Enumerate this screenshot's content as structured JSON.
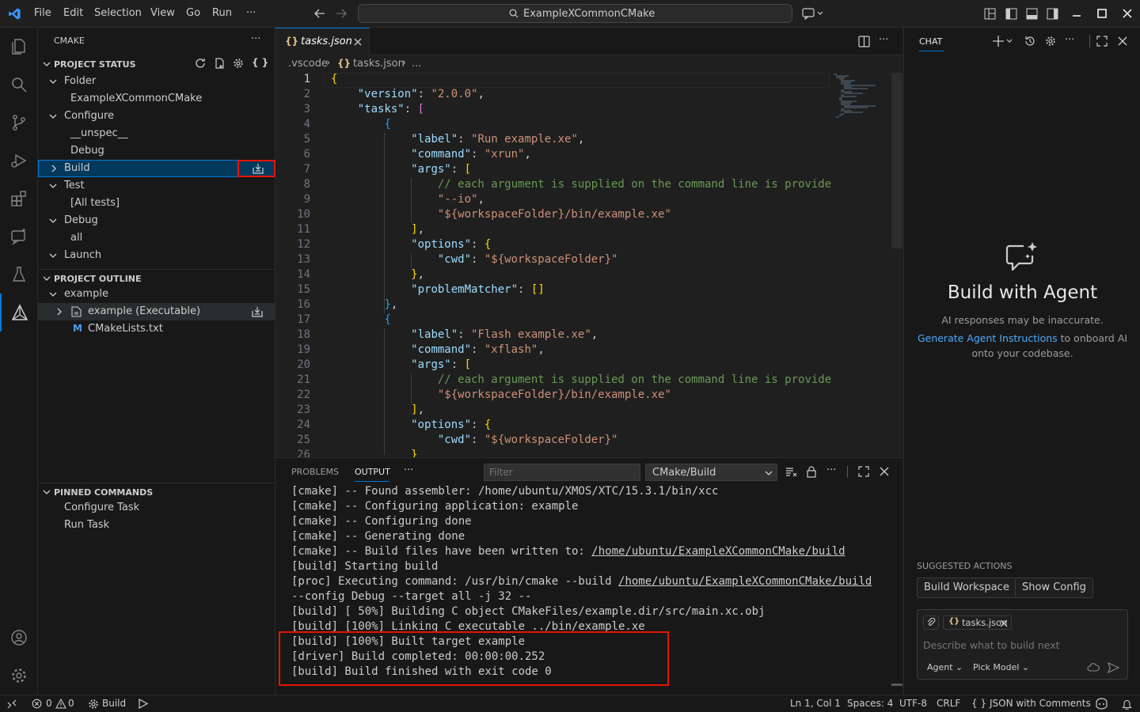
{
  "titlebar": {
    "menu": [
      "File",
      "Edit",
      "Selection",
      "View",
      "Go",
      "Run",
      "···"
    ],
    "search_text": "ExampleXCommonCMake"
  },
  "sidebar": {
    "title": "CMAKE",
    "more": "···",
    "project_status": {
      "header": "PROJECT STATUS",
      "folder": "Folder",
      "folder_value": "ExampleXCommonCMake",
      "configure": "Configure",
      "configure_preset": "__unspec__",
      "configure_type": "Debug",
      "build": "Build",
      "test": "Test",
      "test_value": "[All tests]",
      "debug": "Debug",
      "debug_value": "all",
      "launch": "Launch"
    },
    "project_outline": {
      "header": "PROJECT OUTLINE",
      "project": "example",
      "target": "example (Executable)",
      "file": "CMakeLists.txt"
    },
    "pinned": {
      "header": "PINNED COMMANDS",
      "items": [
        "Configure Task",
        "Run Task"
      ]
    }
  },
  "editor": {
    "tab_label": "tasks.json",
    "tab_icon": "{}",
    "breadcrumb": [
      ".vscode",
      "tasks.json",
      "..."
    ],
    "cursor_line": 1
  },
  "code_lines": [
    "{",
    "    \"version\": \"2.0.0\",",
    "    \"tasks\": [",
    "        {",
    "            \"label\": \"Run example.xe\",",
    "            \"command\": \"xrun\",",
    "            \"args\": [",
    "                // each argument is supplied on the command line is provide",
    "                \"--io\",",
    "                \"${workspaceFolder}/bin/example.xe\"",
    "            ],",
    "            \"options\": {",
    "                \"cwd\": \"${workspaceFolder}\"",
    "            },",
    "            \"problemMatcher\": []",
    "        },",
    "        {",
    "            \"label\": \"Flash example.xe\",",
    "            \"command\": \"xflash\",",
    "            \"args\": [",
    "                // each argument is supplied on the command line is provide",
    "                \"${workspaceFolder}/bin/example.xe\"",
    "            ],",
    "            \"options\": {",
    "                \"cwd\": \"${workspaceFolder}\"",
    "            }"
  ],
  "panel": {
    "tabs": [
      "PROBLEMS",
      "OUTPUT",
      "···"
    ],
    "active_tab": "OUTPUT",
    "filter_placeholder": "Filter",
    "channel": "CMake/Build",
    "lines": [
      "[cmake] -- Found assembler: /home/ubuntu/XMOS/XTC/15.3.1/bin/xcc",
      "[cmake] -- Configuring application: example",
      "[cmake] -- Configuring done",
      "[cmake] -- Generating done",
      "[cmake] -- Build files have been written to: ",
      "[build] Starting build",
      "[proc] Executing command: /usr/bin/cmake --build ",
      "--config Debug --target all -j 32 --",
      "[build] [ 50%] Building C object CMakeFiles/example.dir/src/main.xc.obj",
      "[build] [100%] Linking C executable ../bin/example.xe",
      "[build] [100%] Built target example",
      "[driver] Build completed: 00:00:00.252",
      "[build] Build finished with exit code 0"
    ],
    "link_path": "/home/ubuntu/ExampleXCommonCMake/build"
  },
  "chat": {
    "title": "CHAT",
    "heading": "Build with Agent",
    "disclaimer": "AI responses may be inaccurate.",
    "link": "Generate Agent Instructions",
    "link_suffix": " to onboard AI",
    "line3": "onto your codebase.",
    "suggested_header": "SUGGESTED ACTIONS",
    "suggested": [
      "Build Workspace",
      "Show Config"
    ],
    "attachment": "tasks.json",
    "input_placeholder": "Describe what to build next",
    "mode": "Agent",
    "model": "Pick Model"
  },
  "statusbar": {
    "errors": "0",
    "warnings": "0",
    "build": "Build",
    "position": "Ln 1, Col 1",
    "spaces": "Spaces: 4",
    "encoding": "UTF-8",
    "eol": "CRLF",
    "language": "JSON with Comments",
    "language_icon": "{ }"
  },
  "colors": {
    "accent": "#0078d4",
    "highlight": "#e51400",
    "link": "#4daafc"
  }
}
